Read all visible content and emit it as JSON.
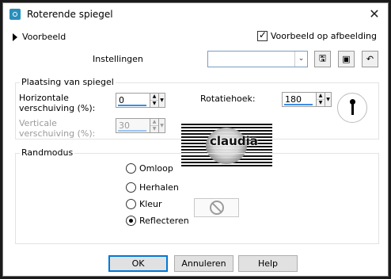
{
  "window": {
    "title": "Roterende spiegel",
    "close_symbol": "✕",
    "app_icon": "camera-icon"
  },
  "header": {
    "preview_toggle": "Voorbeeld",
    "preview_checkbox_label": "Voorbeeld op afbeelding",
    "preview_checked": true,
    "settings_label": "Instellingen",
    "settings_value": ""
  },
  "placement": {
    "group_title": "Plaatsing van spiegel",
    "horizontal_label_1": "Horizontale",
    "horizontal_label_2": "verschuiving (%):",
    "horizontal_value": "0",
    "vertical_label_1": "Verticale",
    "vertical_label_2": "verschuiving (%):",
    "vertical_value": "30",
    "rotation_label": "Rotatiehoek:",
    "rotation_value": "180"
  },
  "logo": {
    "text": "claudia"
  },
  "edge_mode": {
    "group_title": "Randmodus",
    "options": [
      "Omloop",
      "Herhalen",
      "Kleur",
      "Reflecteren"
    ],
    "selected": "Reflecteren"
  },
  "buttons": {
    "ok": "OK",
    "cancel": "Annuleren",
    "help": "Help"
  }
}
